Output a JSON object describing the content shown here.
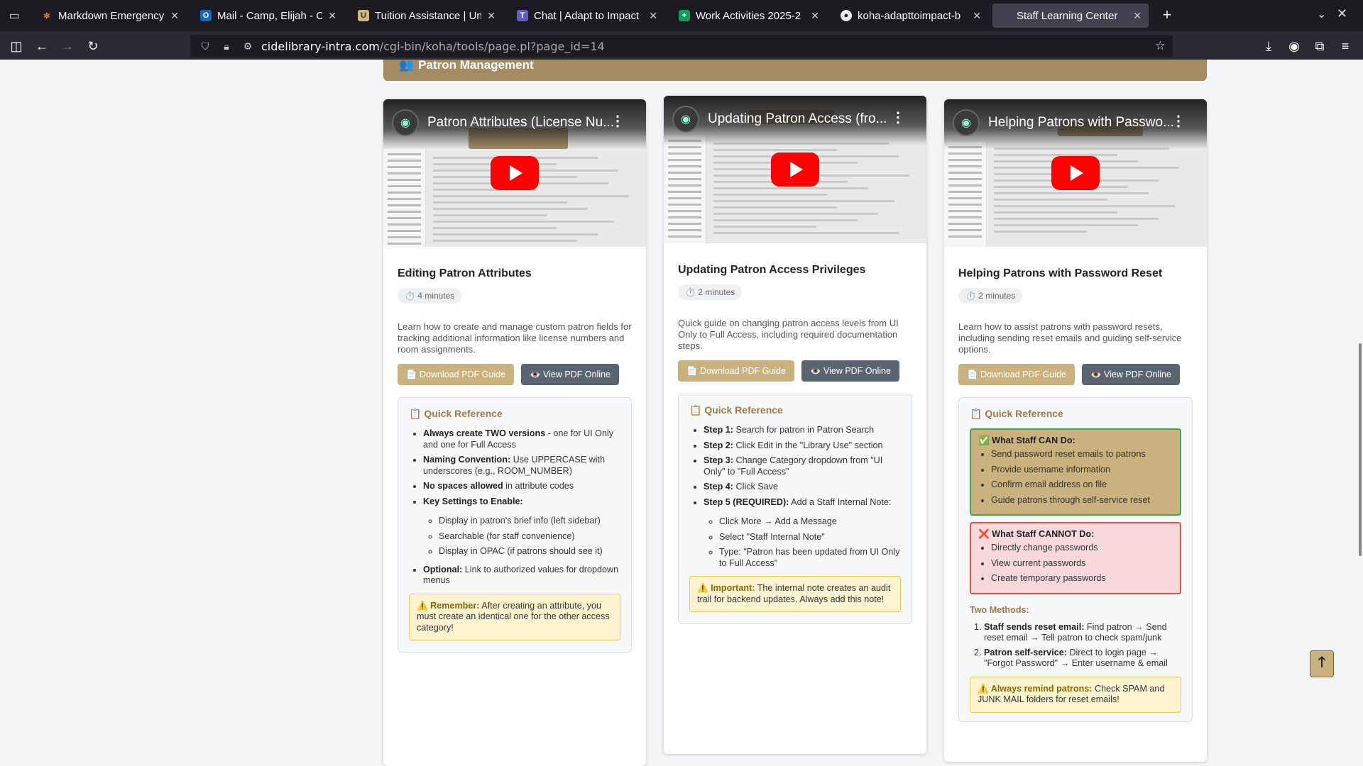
{
  "browser": {
    "tabs": [
      {
        "title": "Markdown Emergency",
        "favicon": "✻",
        "color": "#e8744a"
      },
      {
        "title": "Mail - Camp, Elijah - Outlook",
        "favicon": "O",
        "color": "#0f6cbd"
      },
      {
        "title": "Tuition Assistance | Un",
        "favicon": "U",
        "color": "#cfb87c"
      },
      {
        "title": "Chat | Adapt to Impact",
        "favicon": "T",
        "color": "#5b5fc7"
      },
      {
        "title": "Work Activities 2025-2",
        "favicon": "+",
        "color": "#0f9d58"
      },
      {
        "title": "koha-adapttoimpact-b",
        "favicon": "●",
        "color": "#444444"
      },
      {
        "title": "Staff Learning Center",
        "favicon": "",
        "color": "#42414d"
      }
    ],
    "new_tab": "+",
    "url_host": "cidelibrary-intra.com",
    "url_path": "/cgi-bin/koha/tools/page.pl?page_id=14"
  },
  "section": {
    "title": "Patron Management",
    "icon": "people-icon"
  },
  "cards": [
    {
      "video_title": "Patron Attributes (License Nu...",
      "title": "Editing Patron Attributes",
      "duration": "⏱️ 4 minutes",
      "description": "Learn how to create and manage custom patron fields for tracking additional information like license numbers and room assignments.",
      "download_label": "📄 Download PDF Guide",
      "view_label": "👁️ View PDF Online",
      "qref_title": "📋 Quick Reference",
      "items": [
        {
          "bold": "Always create TWO versions",
          "text": " - one for UI Only and one for Full Access"
        },
        {
          "bold": "Naming Convention:",
          "text": " Use UPPERCASE with underscores (e.g., ROOM_NUMBER)"
        },
        {
          "bold": "No spaces allowed",
          "text": " in attribute codes"
        },
        {
          "bold": "Key Settings to Enable:",
          "text": ""
        }
      ],
      "subitems": [
        "Display in patron's brief info (left sidebar)",
        "Searchable (for staff convenience)",
        "Display in OPAC (if patrons should see it)"
      ],
      "optional": {
        "bold": "Optional:",
        "text": " Link to authorized values for dropdown menus"
      },
      "note": {
        "bold": "⚠️ Remember:",
        "text": " After creating an attribute, you must create an identical one for the other access category!"
      }
    },
    {
      "video_title": "Updating Patron Access (fro...",
      "title": "Updating Patron Access Privileges",
      "duration": "⏱️ 2 minutes",
      "description": "Quick guide on changing patron access levels from UI Only to Full Access, including required documentation steps.",
      "download_label": "📄 Download PDF Guide",
      "view_label": "👁️ View PDF Online",
      "qref_title": "📋 Quick Reference",
      "steps": [
        {
          "bold": "Step 1:",
          "text": " Search for patron in Patron Search"
        },
        {
          "bold": "Step 2:",
          "text": " Click Edit in the \"Library Use\" section"
        },
        {
          "bold": "Step 3:",
          "text": " Change Category dropdown from \"UI Only\" to \"Full Access\""
        },
        {
          "bold": "Step 4:",
          "text": " Click Save"
        },
        {
          "bold": "Step 5 (REQUIRED):",
          "text": " Add a Staff Internal Note:"
        }
      ],
      "substeps": [
        "Click More → Add a Message",
        "Select \"Staff Internal Note\"",
        "Type: \"Patron has been updated from UI Only to Full Access\""
      ],
      "note": {
        "bold": "⚠️ Important:",
        "text": " The internal note creates an audit trail for backend updates. Always add this note!"
      }
    },
    {
      "video_title": "Helping Patrons with Passwo...",
      "title": "Helping Patrons with Password Reset",
      "duration": "⏱️ 2 minutes",
      "description": "Learn how to assist patrons with password resets, including sending reset emails and guiding self-service options.",
      "download_label": "📄 Download PDF Guide",
      "view_label": "👁️ View PDF Online",
      "qref_title": "📋 Quick Reference",
      "can_title": "✅ What Staff CAN Do:",
      "can": [
        "Send password reset emails to patrons",
        "Provide username information",
        "Confirm email address on file",
        "Guide patrons through self-service reset"
      ],
      "cannot_title": "❌ What Staff CANNOT Do:",
      "cannot": [
        "Directly change passwords",
        "View current passwords",
        "Create temporary passwords"
      ],
      "methods_title": "Two Methods:",
      "methods": [
        {
          "bold": "Staff sends reset email:",
          "text": " Find patron → Send reset email → Tell patron to check spam/junk"
        },
        {
          "bold": "Patron self-service:",
          "text": " Direct to login page → \"Forgot Password\" → Enter username & email"
        }
      ],
      "note": {
        "bold": "⚠️ Always remind patrons:",
        "text": " Check SPAM and JUNK MAIL folders for reset emails!"
      }
    }
  ],
  "scroll_top_label": "🡑",
  "colors": {
    "accent": "#a48c62",
    "button_gold": "#c9b27d",
    "button_gray": "#5b6571",
    "note_bg": "#fff4cf"
  }
}
